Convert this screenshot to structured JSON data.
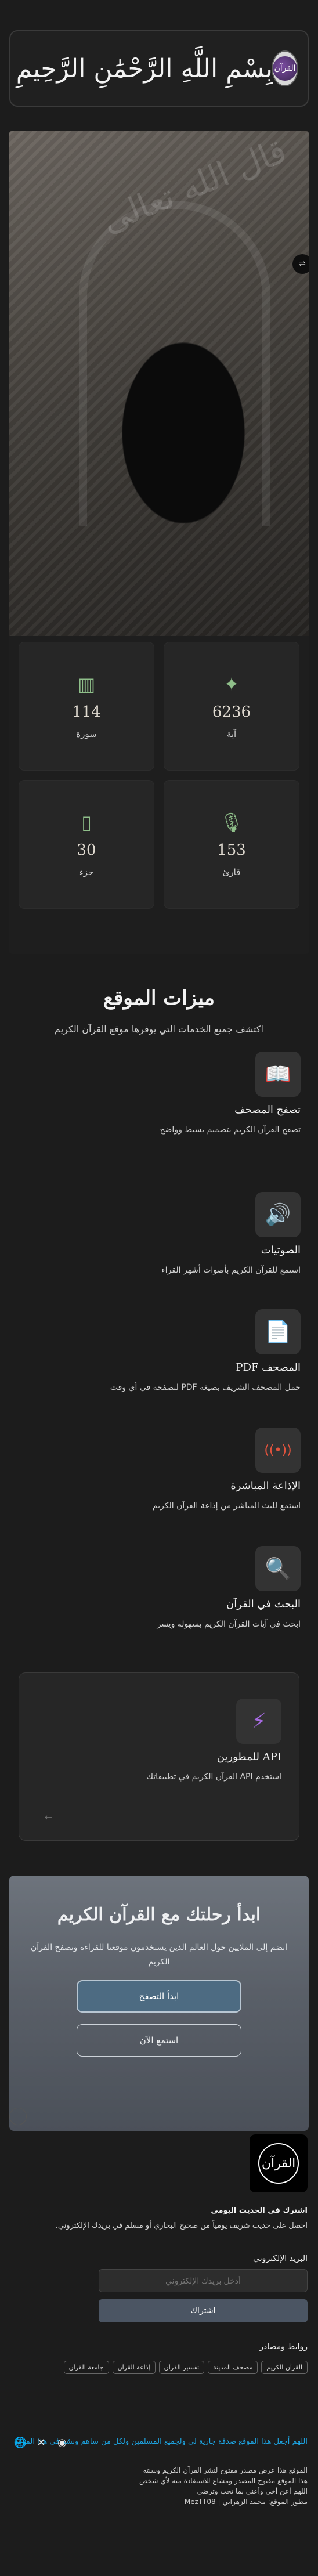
{
  "header": {
    "logo_text": "القرآن",
    "basmala": "بِسْمِ اللَّهِ الرَّحْمَٰنِ الرَّحِيمِ"
  },
  "hero": {
    "script_text": "قال الله تعالى",
    "side_button": "⇌"
  },
  "stats": [
    {
      "icon": "sparkle-icon",
      "glyph": "✦",
      "value": "6236",
      "label": "آية"
    },
    {
      "icon": "book-icon",
      "glyph": "▥",
      "value": "114",
      "label": "سورة"
    },
    {
      "icon": "microphone-icon",
      "glyph": "🎙",
      "value": "153",
      "label": "قارئ"
    },
    {
      "icon": "book-open-icon",
      "glyph": "▯",
      "value": "30",
      "label": "جزء"
    }
  ],
  "features_section": {
    "title": "ميزات الموقع",
    "subtitle": "اكتشف جميع الخدمات التي يوفرها موقع القرآن الكريم"
  },
  "features": [
    {
      "icon": "open-book-icon",
      "glyph": "📖",
      "color": "#4b5d6e",
      "title": "تصفح المصحف",
      "desc": "تصفح القرآن الكريم بتصميم بسيط وواضح"
    },
    {
      "icon": "speaker-icon",
      "glyph": "🔊",
      "color": "#5fbf6a",
      "title": "الصوتيات",
      "desc": "استمع للقرآن الكريم بأصوات أشهر القراء"
    },
    {
      "icon": "document-icon",
      "glyph": "📄",
      "color": "#e7a23a",
      "title": "المصحف PDF",
      "desc": "حمل المصحف الشريف بصيغة PDF لتصفحه في أي وقت"
    },
    {
      "icon": "broadcast-icon",
      "glyph": "((•))",
      "color": "#e0533d",
      "title": "الإذاعة المباشرة",
      "desc": "استمع للبث المباشر من إذاعة القرآن الكريم"
    },
    {
      "icon": "search-icon",
      "glyph": "🔍",
      "color": "#4aa0d8",
      "title": "البحث في القرآن",
      "desc": "ابحث في آيات القرآن الكريم بسهولة ويسر"
    }
  ],
  "api": {
    "icon": "bolt-icon",
    "glyph": "⚡",
    "title": "API للمطورين",
    "desc": "استخدم API القرآن الكريم في تطبيقاتك",
    "arrow": "←"
  },
  "cta": {
    "heading": "ابدأ رحلتك مع القرآن الكريم",
    "subtitle": "انضم إلى الملايين حول العالم الذين يستخدمون موقعنا للقراءة وتصفح القرآن الكريم",
    "primary": "ابدأ التصفح",
    "secondary": "استمع الآن"
  },
  "footer": {
    "logo_text": "القرآن",
    "subscribe_title": "اشترك في الحديث اليومي",
    "subscribe_desc": "احصل على حديث شريف يومياً من صحيح البخاري أو مسلم في بريدك الإلكتروني.",
    "email_label": "البريد الإلكتروني",
    "email_placeholder": "أدخل بريدك الإلكتروني",
    "subscribe_button": "اشتراك",
    "links_title": "روابط ومصادر",
    "links": [
      "القرآن الكريم",
      "مصحف المدينة",
      "تفسير القرآن",
      "إذاعة القرآن",
      "جامعة القرآن"
    ],
    "dua": "اللهم أجعل هذا الموقع صدقة جارية لي ولجميع المسلمين ولكل من ساهم ونشر في هذا الموقع",
    "lines": [
      "الموقع هذا عرض مصدر مفتوح لنشر القرآن الكريم وسنته",
      "هذا الموقع مفتوح المصدر ومشاع للاستفادة منه لأي شخص",
      "اللهم أعن أخي وأعني بما تحب وترضى",
      "مطور الموقع: محمد الزهراني | MezTT08"
    ],
    "socials": [
      {
        "icon": "globe-icon",
        "glyph": "🌐"
      },
      {
        "icon": "x-icon",
        "glyph": "✕"
      },
      {
        "icon": "github-icon",
        "glyph": "◉"
      }
    ]
  }
}
